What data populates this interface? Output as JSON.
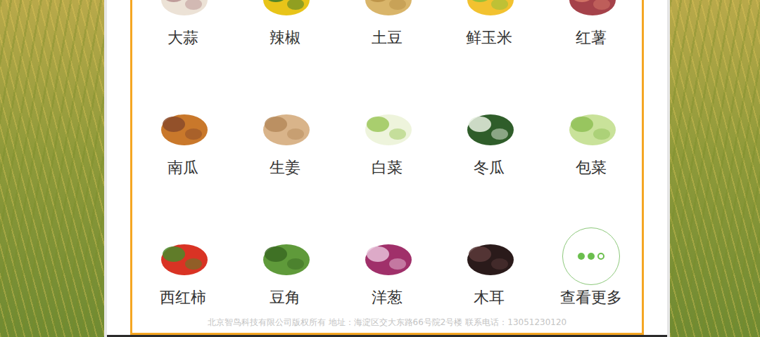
{
  "grid": {
    "items": [
      {
        "label": "大蒜",
        "kind": "item"
      },
      {
        "label": "辣椒",
        "kind": "item"
      },
      {
        "label": "土豆",
        "kind": "item"
      },
      {
        "label": "鲜玉米",
        "kind": "item"
      },
      {
        "label": "红薯",
        "kind": "item"
      },
      {
        "label": "南瓜",
        "kind": "item"
      },
      {
        "label": "生姜",
        "kind": "item"
      },
      {
        "label": "白菜",
        "kind": "item"
      },
      {
        "label": "冬瓜",
        "kind": "item"
      },
      {
        "label": "包菜",
        "kind": "item"
      },
      {
        "label": "西红柿",
        "kind": "item"
      },
      {
        "label": "豆角",
        "kind": "item"
      },
      {
        "label": "洋葱",
        "kind": "item"
      },
      {
        "label": "木耳",
        "kind": "item"
      },
      {
        "label": "查看更多",
        "kind": "more"
      }
    ]
  },
  "footer": {
    "text": "北京智鸟科技有限公司版权所有 地址：海淀区交大东路66号院2号楼 联系电话：13051230120"
  }
}
